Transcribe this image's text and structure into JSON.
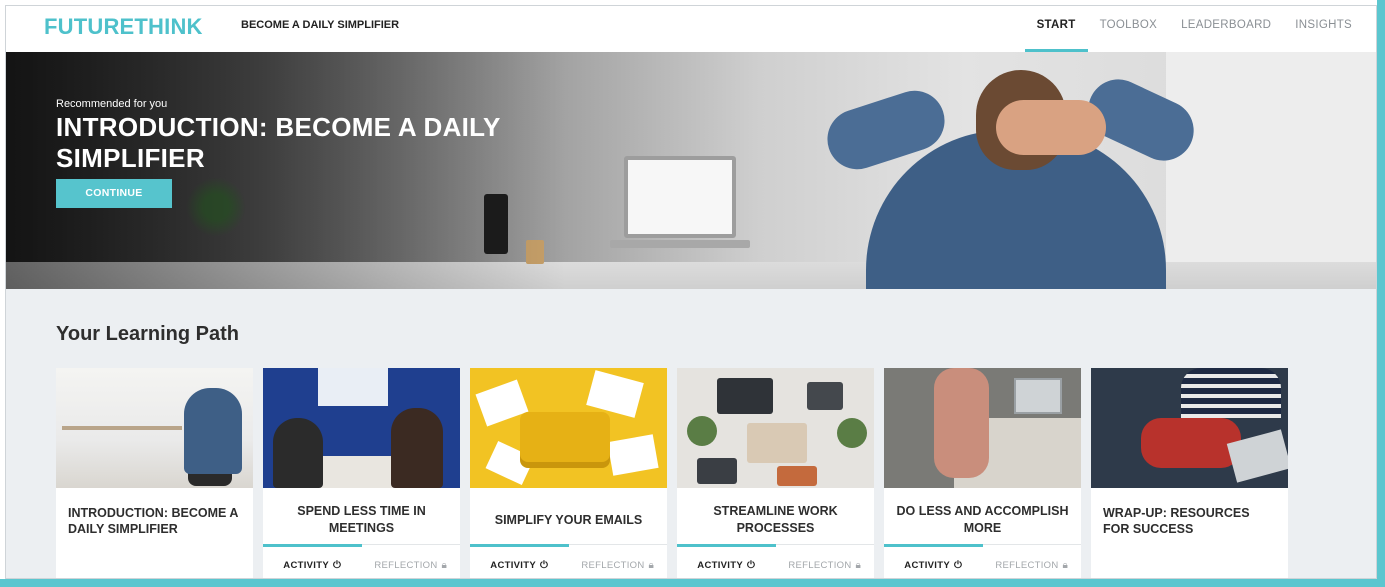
{
  "brand": {
    "logo": "FUTURETHINK",
    "course_title": "BECOME A DAILY SIMPLIFIER",
    "accent_color": "#4ec1cb"
  },
  "nav": {
    "items": [
      {
        "label": "START",
        "active": true
      },
      {
        "label": "TOOLBOX",
        "active": false
      },
      {
        "label": "LEADERBOARD",
        "active": false
      },
      {
        "label": "INSIGHTS",
        "active": false
      }
    ]
  },
  "hero": {
    "kicker": "Recommended for you",
    "title": "INTRODUCTION: BECOME A DAILY SIMPLIFIER",
    "button_label": "CONTINUE"
  },
  "learning_path": {
    "title": "Your Learning Path",
    "cards": [
      {
        "title": "INTRODUCTION: BECOME A DAILY SIMPLIFIER",
        "has_tabs": false
      },
      {
        "title": "SPEND LESS TIME IN MEETINGS",
        "has_tabs": true,
        "activity_label": "ACTIVITY",
        "reflection_label": "REFLECTION"
      },
      {
        "title": "SIMPLIFY YOUR EMAILS",
        "has_tabs": true,
        "activity_label": "ACTIVITY",
        "reflection_label": "REFLECTION"
      },
      {
        "title": "STREAMLINE WORK PROCESSES",
        "has_tabs": true,
        "activity_label": "ACTIVITY",
        "reflection_label": "REFLECTION"
      },
      {
        "title": "DO LESS AND ACCOMPLISH MORE",
        "has_tabs": true,
        "activity_label": "ACTIVITY",
        "reflection_label": "REFLECTION"
      },
      {
        "title": "WRAP-UP: RESOURCES FOR SUCCESS",
        "has_tabs": false
      }
    ],
    "icons": {
      "activity": "power-icon",
      "reflection": "lock-icon"
    }
  }
}
